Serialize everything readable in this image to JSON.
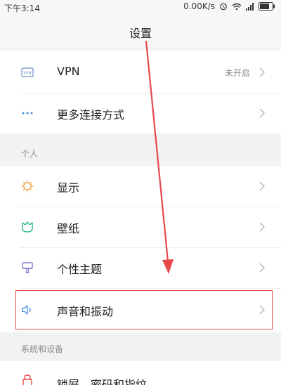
{
  "status_bar": {
    "time": "下午3:14",
    "speed": "0.00K/s"
  },
  "header": {
    "title": "设置"
  },
  "network": {
    "items": [
      {
        "label": "VPN",
        "value": "未开启",
        "icon": "vpn-icon"
      },
      {
        "label": "更多连接方式",
        "value": "",
        "icon": "more-dots-icon"
      }
    ]
  },
  "personal": {
    "header": "个人",
    "items": [
      {
        "label": "显示",
        "icon": "brightness-icon"
      },
      {
        "label": "壁纸",
        "icon": "wallpaper-icon"
      },
      {
        "label": "个性主题",
        "icon": "theme-icon"
      },
      {
        "label": "声音和振动",
        "icon": "speaker-icon"
      }
    ]
  },
  "system": {
    "header": "系统和设备",
    "items": [
      {
        "label": "锁屏、密码和指纹",
        "icon": "lock-icon"
      }
    ]
  },
  "colors": {
    "accent_orange": "#f29b3a",
    "accent_green": "#2db38a",
    "accent_purple": "#8a7cd4",
    "accent_blue": "#3e8de0",
    "accent_red": "#e14a4a",
    "highlight_red": "#e8494a"
  }
}
